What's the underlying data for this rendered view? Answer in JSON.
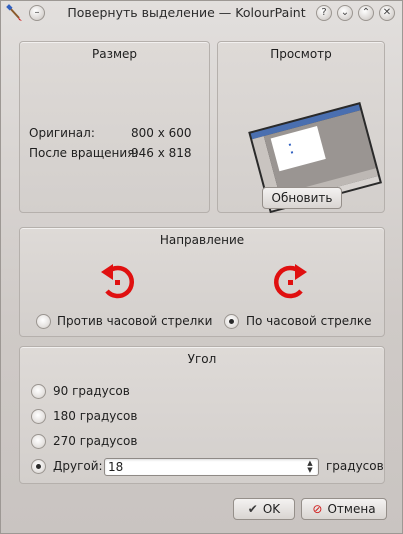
{
  "window": {
    "title": "Повернуть выделение — KolourPaint",
    "icon": "kolourpaint-brush-icon"
  },
  "size_group": {
    "title": "Размер",
    "original_label": "Оригинал:",
    "original_value": "800 x 600",
    "rotated_label": "После вращения:",
    "rotated_value": "946 x 818"
  },
  "preview_group": {
    "title": "Просмотр",
    "update_button": "Обновить"
  },
  "direction_group": {
    "title": "Направление",
    "ccw_label": "Против часовой стрелки",
    "cw_label": "По часовой стрелке",
    "selected": "cw",
    "arrow_color": "#e01010"
  },
  "angle_group": {
    "title": "Угол",
    "option_90": "90 градусов",
    "option_180": "180 градусов",
    "option_270": "270 градусов",
    "option_other": "Другой:",
    "other_value": "18",
    "other_unit": "градусов",
    "selected": "other"
  },
  "buttons": {
    "ok": "OK",
    "cancel": "Отмена"
  }
}
